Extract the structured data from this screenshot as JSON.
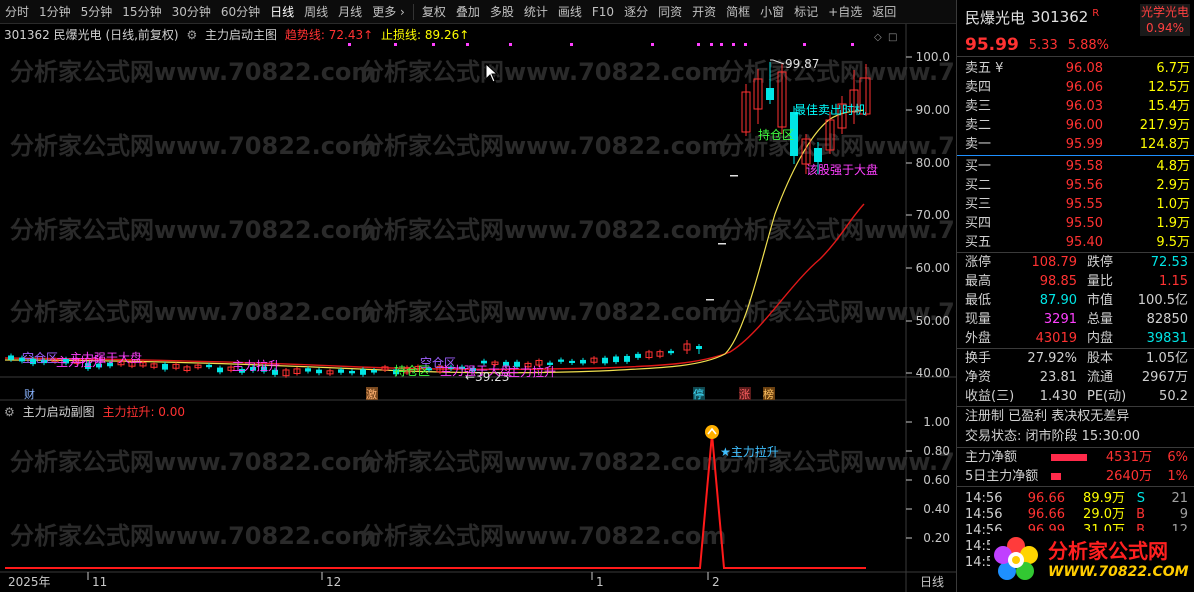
{
  "toolbar": {
    "periods": [
      "分时",
      "1分钟",
      "5分钟",
      "15分钟",
      "30分钟",
      "60分钟",
      "日线",
      "周线",
      "月线",
      "更多 ›"
    ],
    "active_period": "日线",
    "tools": [
      "复权",
      "叠加",
      "多股",
      "统计",
      "画线",
      "F10",
      "逐分",
      "同资",
      "开资",
      "简框",
      "小窗",
      "标记",
      "+自选",
      "返回"
    ]
  },
  "main_chart": {
    "stock_label": "301362 民爆光电 (日线,前复权)",
    "indicator_name": "主力启动主图",
    "trend_line_label": "趋势线: 72.43↑",
    "stop_line_label": "止损线: 89.26↑",
    "high_marker": "99.87",
    "low_marker": "←39.23",
    "price_axis": [
      "100.0",
      "90.00",
      "80.00",
      "70.00",
      "60.00",
      "50.00",
      "40.00"
    ],
    "annotations": {
      "zone1": "空仓区",
      "strong1": "主力强于大盘",
      "pull1": "主力拉升",
      "pull2": "主力拉升",
      "hold1": "持仓区",
      "zone2": "空仓区",
      "strong2": "主力强于大盘",
      "pull3": "主力拉升",
      "hold2": "持仓区",
      "best_sell": "最佳卖出时机",
      "strong3": "该股强于大盘"
    },
    "event_tags": {
      "cai": "财",
      "ji": "激",
      "ting": "停",
      "zhang": "涨",
      "bang": "榜"
    }
  },
  "sub_chart": {
    "name": "主力启动副图",
    "value_label": "主力拉升: 0.00",
    "axis": [
      "1.00",
      "0.80",
      "0.60",
      "0.40",
      "0.20"
    ],
    "signal_label": "★主力拉升"
  },
  "time_axis": {
    "labels": [
      "2025年",
      "11",
      "12",
      "1",
      "2"
    ],
    "period": "日线"
  },
  "quote": {
    "name": "民爆光电",
    "code": "301362",
    "r_badge": "R",
    "sector": "光学光电",
    "sector_pct": "0.94%",
    "price": "95.99",
    "change": "5.33",
    "change_pct": "5.88%",
    "asks": [
      {
        "label": "卖五 ¥",
        "price": "96.08",
        "vol": "6.7万"
      },
      {
        "label": "卖四",
        "price": "96.06",
        "vol": "12.5万"
      },
      {
        "label": "卖三",
        "price": "96.03",
        "vol": "15.4万"
      },
      {
        "label": "卖二",
        "price": "96.00",
        "vol": "217.9万"
      },
      {
        "label": "卖一",
        "price": "95.99",
        "vol": "124.8万"
      }
    ],
    "bids": [
      {
        "label": "买一",
        "price": "95.58",
        "vol": "4.8万"
      },
      {
        "label": "买二",
        "price": "95.56",
        "vol": "2.9万"
      },
      {
        "label": "买三",
        "price": "95.55",
        "vol": "1.0万"
      },
      {
        "label": "买四",
        "price": "95.50",
        "vol": "1.9万"
      },
      {
        "label": "买五",
        "price": "95.40",
        "vol": "9.5万"
      }
    ],
    "stats1": [
      {
        "k1": "涨停",
        "v1": "108.79",
        "k2": "跌停",
        "v2": "72.53"
      },
      {
        "k1": "最高",
        "v1": "98.85",
        "k2": "量比",
        "v2": "1.15"
      },
      {
        "k1": "最低",
        "v1": "87.90",
        "k2": "市值",
        "v2": "100.5亿"
      },
      {
        "k1": "现量",
        "v1": "3291",
        "k2": "总量",
        "v2": "82850"
      },
      {
        "k1": "外盘",
        "v1": "43019",
        "k2": "内盘",
        "v2": "39831"
      }
    ],
    "stats2": [
      {
        "k1": "换手",
        "v1": "27.92%",
        "k2": "股本",
        "v2": "1.05亿"
      },
      {
        "k1": "净资",
        "v1": "23.81",
        "k2": "流通",
        "v2": "2967万"
      },
      {
        "k1": "收益(三)",
        "v1": "1.430",
        "k2": "PE(动)",
        "v2": "50.2"
      }
    ],
    "reg_info": "注册制 已盈利 表决权无差异",
    "trade_status": "交易状态: 闭市阶段 15:30:00",
    "flows": [
      {
        "label": "主力净额",
        "value": "4531万",
        "pct": "6%",
        "bar": 0.75
      },
      {
        "label": "5日主力净额",
        "value": "2640万",
        "pct": "1%",
        "bar": 0.4
      }
    ],
    "ticks": [
      {
        "time": "14:56",
        "price": "96.66",
        "vol": "89.9万",
        "side": "S",
        "n": "21"
      },
      {
        "time": "14:56",
        "price": "96.66",
        "vol": "29.0万",
        "side": "B",
        "n": "9"
      },
      {
        "time": "14:56",
        "price": "96.99",
        "vol": "31.0万",
        "side": "B",
        "n": "12"
      },
      {
        "time": "14:56",
        "price": "",
        "vol": "",
        "side": "",
        "n": ""
      },
      {
        "time": "14:56",
        "price": "",
        "vol": "",
        "side": "",
        "n": ""
      }
    ]
  },
  "watermark": "分析家公式网www.70822.com",
  "logo": {
    "title": "分析家公式网",
    "url": "WWW.70822.COM"
  },
  "colors": {
    "up": "#ff3232",
    "down": "#00e5e5",
    "trend": "#ffff00",
    "stop": "#e01818"
  }
}
